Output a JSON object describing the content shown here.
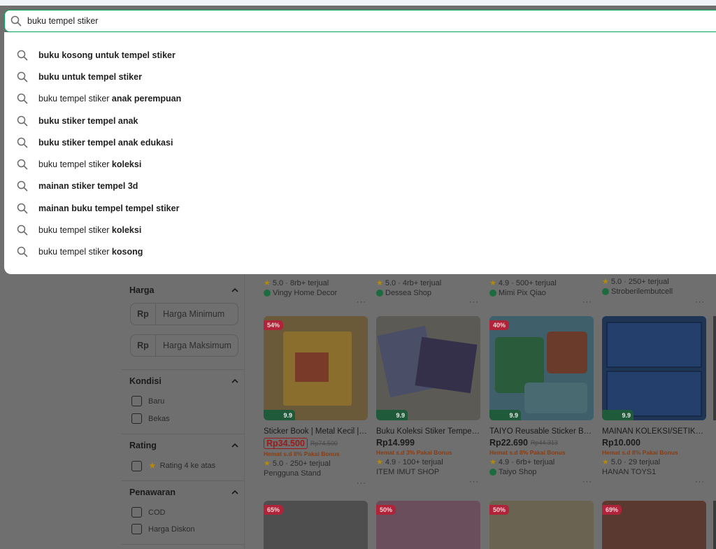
{
  "search": {
    "query": "buku tempel stiker"
  },
  "suggestions": [
    {
      "plain": "",
      "bold": "buku kosong untuk tempel stiker"
    },
    {
      "plain": "",
      "bold": "buku untuk tempel stiker"
    },
    {
      "plain": "buku tempel stiker ",
      "bold": "anak perempuan"
    },
    {
      "plain": "",
      "bold": "buku stiker tempel anak"
    },
    {
      "plain": "",
      "bold": "buku stiker tempel anak edukasi"
    },
    {
      "plain": "buku tempel stiker ",
      "bold": "koleksi"
    },
    {
      "plain": "",
      "bold": "mainan stiker tempel 3d"
    },
    {
      "plain": "",
      "bold": "mainan buku tempel tempel stiker"
    },
    {
      "plain": "buku tempel stiker ",
      "bold": "koleksi"
    },
    {
      "plain": "buku tempel stiker ",
      "bold": "kosong"
    }
  ],
  "filters": {
    "harga": {
      "title": "Harga",
      "rp": "Rp",
      "min_placeholder": "Harga Minimum",
      "max_placeholder": "Harga Maksimum"
    },
    "kondisi": {
      "title": "Kondisi",
      "options": [
        "Baru",
        "Bekas"
      ]
    },
    "rating": {
      "title": "Rating",
      "option": "Rating 4 ke atas"
    },
    "penawaran": {
      "title": "Penawaran",
      "options": [
        "COD",
        "Harga Diskon"
      ]
    }
  },
  "top_row": [
    {
      "rating": "5.0",
      "sold": "8rb+ terjual",
      "shop": "Vingy Home Decor"
    },
    {
      "rating": "5.0",
      "sold": "4rb+ terjual",
      "shop": "Dessea Shop"
    },
    {
      "rating": "4.9",
      "sold": "500+ terjual",
      "shop": "Mimi Pix Qiao"
    },
    {
      "rating": "5.0",
      "sold": "250+ terjual",
      "shop": "Stroberilembutcell"
    }
  ],
  "products": [
    {
      "badge": "54%",
      "promo": "9.9",
      "title": "Sticker Book | Metal Kecil | ...",
      "price": "Rp34.500",
      "old_price": "Rp74.500",
      "hemat": "Hemat s.d 8% Pakai Bonus",
      "rating": "5.0",
      "sold": "250+ terjual",
      "shop": "Pengguna Stand",
      "color": "#6b5a3a"
    },
    {
      "badge": "",
      "promo": "9.9",
      "title": "Buku Koleksi Stiker Tempel ...",
      "price": "Rp14.999",
      "old_price": "",
      "hemat": "Hemat s.d 3% Pakai Bonus",
      "rating": "4.9",
      "sold": "100+ terjual",
      "shop": "ITEM IMUT SHOP",
      "color": "#5c5a55"
    },
    {
      "badge": "40%",
      "promo": "9.9",
      "title": "TAIYO Reusable Sticker Book...",
      "price": "Rp22.690",
      "old_price": "Rp44.313",
      "hemat": "Hemat s.d 8% Pakai Bonus",
      "rating": "4.9",
      "sold": "6rb+ terjual",
      "shop": "Taiyo Shop",
      "color": "#3f5f6a"
    },
    {
      "badge": "",
      "promo": "9.9",
      "title": "MAINAN KOLEKSI/SETIKER ...",
      "price": "Rp10.000",
      "old_price": "",
      "hemat": "Hemat s.d 8% Pakai Bonus",
      "rating": "5.0",
      "sold": "29 terjual",
      "shop": "HANAN TOYS1",
      "color": "#1f3556"
    }
  ],
  "bottom_row": [
    {
      "badge": "65%",
      "color": "#4e4e4e"
    },
    {
      "badge": "50%",
      "color": "#6a4e5c"
    },
    {
      "badge": "50%",
      "color": "#6a6352"
    },
    {
      "badge": "69%",
      "color": "#5a3a30"
    }
  ]
}
